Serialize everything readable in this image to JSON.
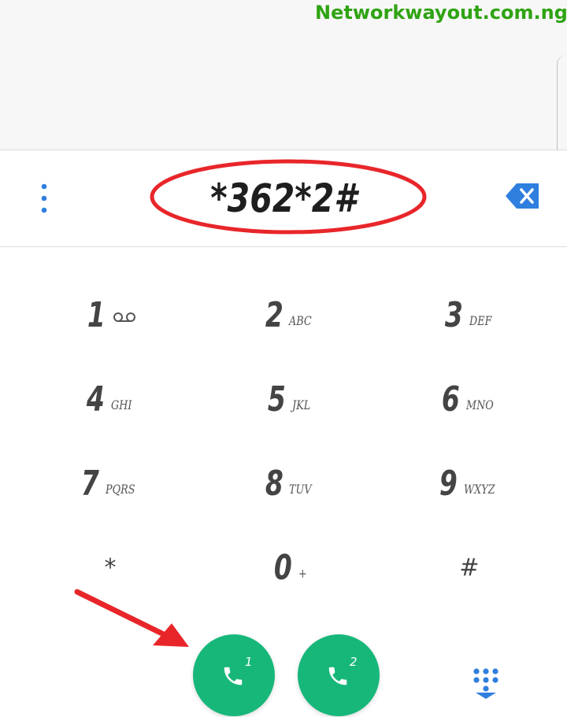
{
  "watermark": "Networkwayout.com.ng",
  "dial_bar": {
    "number": "*362*2#",
    "menu_icon": "more-vert-icon",
    "backspace_icon": "backspace-icon"
  },
  "keypad": {
    "keys": [
      {
        "digit": "1",
        "letters": "",
        "icon": "voicemail-icon"
      },
      {
        "digit": "2",
        "letters": "ABC"
      },
      {
        "digit": "3",
        "letters": "DEF"
      },
      {
        "digit": "4",
        "letters": "GHI"
      },
      {
        "digit": "5",
        "letters": "JKL"
      },
      {
        "digit": "6",
        "letters": "MNO"
      },
      {
        "digit": "7",
        "letters": "PQRS"
      },
      {
        "digit": "8",
        "letters": "TUV"
      },
      {
        "digit": "9",
        "letters": "WXYZ"
      },
      {
        "digit": "*",
        "letters": ""
      },
      {
        "digit": "0",
        "letters": "+"
      },
      {
        "digit": "#",
        "letters": ""
      }
    ]
  },
  "call_buttons": [
    {
      "sim": "1",
      "icon": "phone-icon"
    },
    {
      "sim": "2",
      "icon": "phone-icon"
    }
  ],
  "dialpad_toggle_icon": "dialpad-icon",
  "colors": {
    "call_green": "#17b77a",
    "accent_blue": "#2f7fde",
    "highlight_red": "#e8262a",
    "watermark_green": "#2fa312"
  }
}
